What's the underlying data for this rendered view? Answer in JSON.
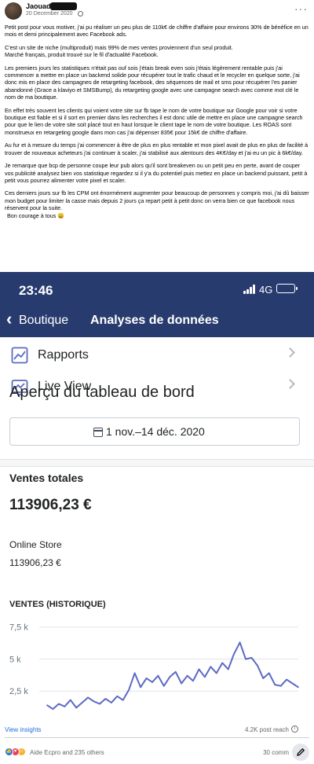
{
  "post": {
    "author": "Jaouad",
    "date": "20 December 2020",
    "paragraphs": [
      "Petit post pour vous motiver, j'ai pu réaliser un peu plus de 110k€ de chiffre d'affaire pour environs 30% de bénéfice en un mois et demi principalement avec Facebook ads.",
      "C'est un site de niche (multiproduit) mais 99% de mes ventes proviennent d'un seul produit.\nMarché français, produit trouvé sur le fil d'actualité Facebook.",
      "Les premiers jours les statistiques n'était pas ouf sois j'étais break even sois j'étais légèrement rentable puis j'ai commencer a mettre en place un backend solide pour récupérer tout le trafic chaud et le recycler en quelque sorte, j'ai donc mis en place des campagnes de retargeting facebook, des séquences de mail et sms pour récupérer l'es panier abandonné (Grace a klaviyo et SMSBump), du retargeting google avec une campagne search avec comme mot clé le nom de ma boutique.",
      "En effet très souvent les clients qui voient votre site sur fb tape le nom de votre boutique sur Google pour voir si votre boutique est fiable et si il sort en premier dans les recherches il est donc utile de mettre en place une campagne search pour que le lien de votre site soit placé tout en haut lorsque le client tape le nom de votre boutique. Les ROAS sont monstrueux en retargeting google dans mon cas j'ai dépenser 835€ pour 15k€ de chiffre d'affaire.",
      "Au fur et à mesure du temps j'ai commencer à être de plus en plus rentable et mon pixel avait de plus en plus de facilité à trouver de nouveaux acheteurs j'ai continuer à scaler, j'ai stabilisé aux alentours des 4K€/day et j'ai eu un pic à 6k€/day.",
      "Je remarque que bcp de personne coupe leur pub alors qu'il sont breakeven ou un petit peu en perte, avant de couper vos publicité analysez bien vos statistique regardez si il y'a du potentiel puis mettez en place un backend puissant, petit à petit vous pourrez alimenter votre pixel et scaler.",
      "Ces derniers jours sur fb les CPM ont énormément augmenter pour beaucoup de personnes y compris moi, j'ai dû baisser mon budget pour limiter la casse mais depuis 2 jours ça repart petit à petit donc on verra bien ce que facebook nous réservent pour la suite."
    ],
    "signoff": "Bon courage à tous 😀"
  },
  "screenshot": {
    "status_time": "23:46",
    "network": "4G",
    "back_label": "Boutique",
    "nav_title": "Analyses de données",
    "menu": [
      {
        "label": "Rapports"
      },
      {
        "label": "Live View"
      }
    ],
    "dashboard_title": "Aperçu du tableau de bord",
    "date_range": "1 nov.–14 déc. 2020",
    "total_sales_label": "Ventes totales",
    "total_sales_value": "113906,23 €",
    "store_label": "Online Store",
    "store_value": "113906,23 €",
    "history_label": "VENTES (HISTORIQUE)"
  },
  "chart_data": {
    "type": "line",
    "title": "VENTES (HISTORIQUE)",
    "xlabel": "",
    "ylabel": "",
    "y_ticks": [
      "7,5 k",
      "5 k",
      "2,5 k"
    ],
    "ylim": [
      0,
      8500
    ],
    "x": [
      0,
      1,
      2,
      3,
      4,
      5,
      6,
      7,
      8,
      9,
      10,
      11,
      12,
      13,
      14,
      15,
      16,
      17,
      18,
      19,
      20,
      21,
      22,
      23,
      24,
      25,
      26,
      27,
      28,
      29,
      30,
      31,
      32,
      33,
      34,
      35,
      36,
      37,
      38,
      39,
      40,
      41,
      42,
      43
    ],
    "series": [
      {
        "values": [
          1400,
          1100,
          1500,
          1300,
          1800,
          1200,
          1600,
          2000,
          1700,
          1500,
          1900,
          1600,
          2100,
          1800,
          2600,
          3900,
          2800,
          3500,
          3200,
          3700,
          2900,
          3600,
          4000,
          3100,
          3700,
          3300,
          4200,
          3600,
          4400,
          3900,
          4700,
          4200,
          5400,
          6300,
          5000,
          5100,
          4500,
          3500,
          3900,
          3000,
          2900,
          3400,
          3100,
          2800
        ]
      }
    ],
    "line_color": "#5c6ac4"
  },
  "footer": {
    "insights": "View insights",
    "reach": "4.2K post reach",
    "reactors": "Aide Ecpro and 235 others",
    "comments": "30 comm"
  },
  "colors": {
    "nav_bg": "#283b6e",
    "link": "#216fdb",
    "chart_line": "#5c6ac4"
  }
}
